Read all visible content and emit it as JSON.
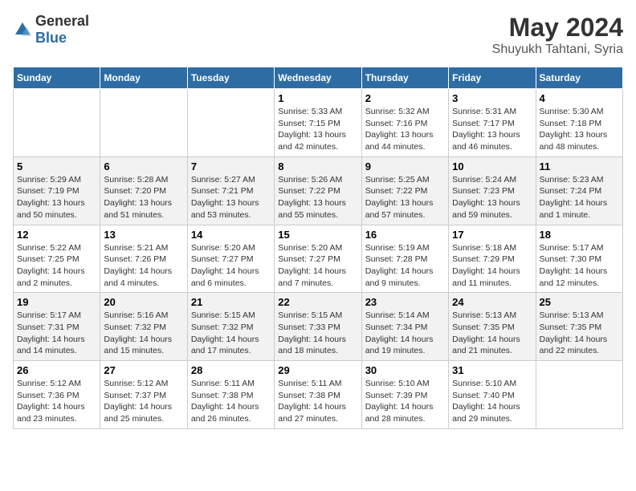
{
  "header": {
    "logo_general": "General",
    "logo_blue": "Blue",
    "title": "May 2024",
    "subtitle": "Shuyukh Tahtani, Syria"
  },
  "calendar": {
    "days_of_week": [
      "Sunday",
      "Monday",
      "Tuesday",
      "Wednesday",
      "Thursday",
      "Friday",
      "Saturday"
    ],
    "weeks": [
      [
        {
          "day": "",
          "info": ""
        },
        {
          "day": "",
          "info": ""
        },
        {
          "day": "",
          "info": ""
        },
        {
          "day": "1",
          "info": "Sunrise: 5:33 AM\nSunset: 7:15 PM\nDaylight: 13 hours\nand 42 minutes."
        },
        {
          "day": "2",
          "info": "Sunrise: 5:32 AM\nSunset: 7:16 PM\nDaylight: 13 hours\nand 44 minutes."
        },
        {
          "day": "3",
          "info": "Sunrise: 5:31 AM\nSunset: 7:17 PM\nDaylight: 13 hours\nand 46 minutes."
        },
        {
          "day": "4",
          "info": "Sunrise: 5:30 AM\nSunset: 7:18 PM\nDaylight: 13 hours\nand 48 minutes."
        }
      ],
      [
        {
          "day": "5",
          "info": "Sunrise: 5:29 AM\nSunset: 7:19 PM\nDaylight: 13 hours\nand 50 minutes."
        },
        {
          "day": "6",
          "info": "Sunrise: 5:28 AM\nSunset: 7:20 PM\nDaylight: 13 hours\nand 51 minutes."
        },
        {
          "day": "7",
          "info": "Sunrise: 5:27 AM\nSunset: 7:21 PM\nDaylight: 13 hours\nand 53 minutes."
        },
        {
          "day": "8",
          "info": "Sunrise: 5:26 AM\nSunset: 7:22 PM\nDaylight: 13 hours\nand 55 minutes."
        },
        {
          "day": "9",
          "info": "Sunrise: 5:25 AM\nSunset: 7:22 PM\nDaylight: 13 hours\nand 57 minutes."
        },
        {
          "day": "10",
          "info": "Sunrise: 5:24 AM\nSunset: 7:23 PM\nDaylight: 13 hours\nand 59 minutes."
        },
        {
          "day": "11",
          "info": "Sunrise: 5:23 AM\nSunset: 7:24 PM\nDaylight: 14 hours\nand 1 minute."
        }
      ],
      [
        {
          "day": "12",
          "info": "Sunrise: 5:22 AM\nSunset: 7:25 PM\nDaylight: 14 hours\nand 2 minutes."
        },
        {
          "day": "13",
          "info": "Sunrise: 5:21 AM\nSunset: 7:26 PM\nDaylight: 14 hours\nand 4 minutes."
        },
        {
          "day": "14",
          "info": "Sunrise: 5:20 AM\nSunset: 7:27 PM\nDaylight: 14 hours\nand 6 minutes."
        },
        {
          "day": "15",
          "info": "Sunrise: 5:20 AM\nSunset: 7:27 PM\nDaylight: 14 hours\nand 7 minutes."
        },
        {
          "day": "16",
          "info": "Sunrise: 5:19 AM\nSunset: 7:28 PM\nDaylight: 14 hours\nand 9 minutes."
        },
        {
          "day": "17",
          "info": "Sunrise: 5:18 AM\nSunset: 7:29 PM\nDaylight: 14 hours\nand 11 minutes."
        },
        {
          "day": "18",
          "info": "Sunrise: 5:17 AM\nSunset: 7:30 PM\nDaylight: 14 hours\nand 12 minutes."
        }
      ],
      [
        {
          "day": "19",
          "info": "Sunrise: 5:17 AM\nSunset: 7:31 PM\nDaylight: 14 hours\nand 14 minutes."
        },
        {
          "day": "20",
          "info": "Sunrise: 5:16 AM\nSunset: 7:32 PM\nDaylight: 14 hours\nand 15 minutes."
        },
        {
          "day": "21",
          "info": "Sunrise: 5:15 AM\nSunset: 7:32 PM\nDaylight: 14 hours\nand 17 minutes."
        },
        {
          "day": "22",
          "info": "Sunrise: 5:15 AM\nSunset: 7:33 PM\nDaylight: 14 hours\nand 18 minutes."
        },
        {
          "day": "23",
          "info": "Sunrise: 5:14 AM\nSunset: 7:34 PM\nDaylight: 14 hours\nand 19 minutes."
        },
        {
          "day": "24",
          "info": "Sunrise: 5:13 AM\nSunset: 7:35 PM\nDaylight: 14 hours\nand 21 minutes."
        },
        {
          "day": "25",
          "info": "Sunrise: 5:13 AM\nSunset: 7:35 PM\nDaylight: 14 hours\nand 22 minutes."
        }
      ],
      [
        {
          "day": "26",
          "info": "Sunrise: 5:12 AM\nSunset: 7:36 PM\nDaylight: 14 hours\nand 23 minutes."
        },
        {
          "day": "27",
          "info": "Sunrise: 5:12 AM\nSunset: 7:37 PM\nDaylight: 14 hours\nand 25 minutes."
        },
        {
          "day": "28",
          "info": "Sunrise: 5:11 AM\nSunset: 7:38 PM\nDaylight: 14 hours\nand 26 minutes."
        },
        {
          "day": "29",
          "info": "Sunrise: 5:11 AM\nSunset: 7:38 PM\nDaylight: 14 hours\nand 27 minutes."
        },
        {
          "day": "30",
          "info": "Sunrise: 5:10 AM\nSunset: 7:39 PM\nDaylight: 14 hours\nand 28 minutes."
        },
        {
          "day": "31",
          "info": "Sunrise: 5:10 AM\nSunset: 7:40 PM\nDaylight: 14 hours\nand 29 minutes."
        },
        {
          "day": "",
          "info": ""
        }
      ]
    ]
  }
}
